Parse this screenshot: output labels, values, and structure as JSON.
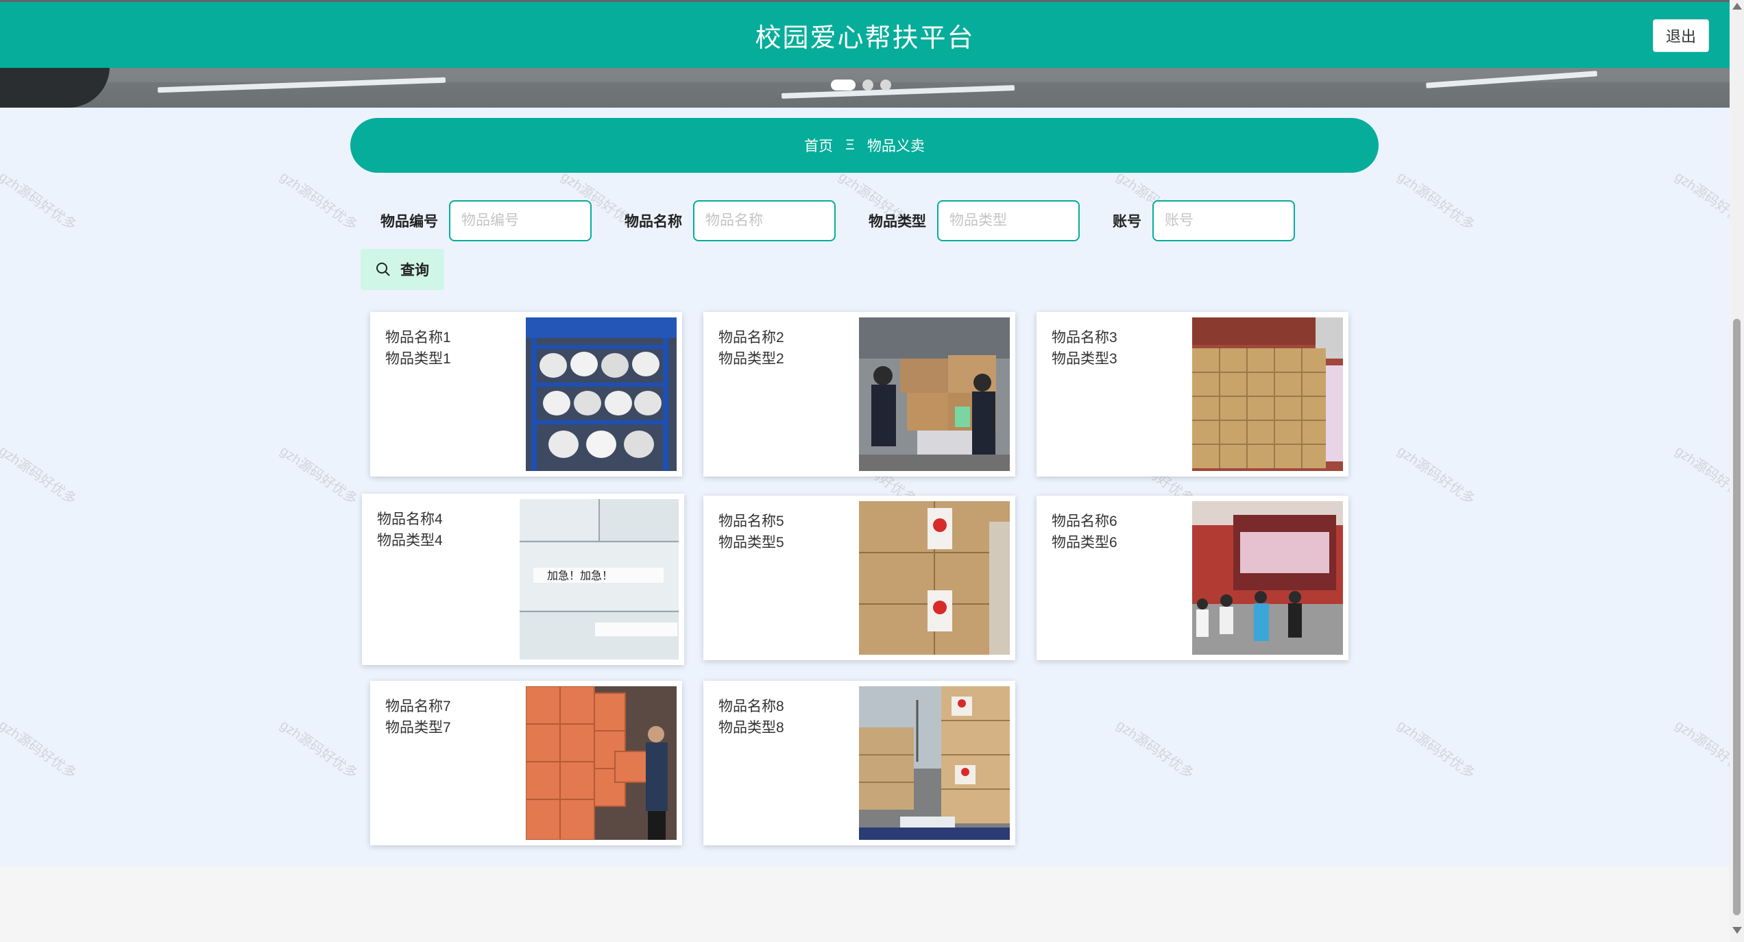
{
  "header": {
    "title": "校园爱心帮扶平台",
    "logout_label": "退出"
  },
  "breadcrumb": {
    "home": "首页",
    "separator": "Ξ",
    "current": "物品义卖"
  },
  "search": {
    "fields": [
      {
        "label": "物品编号",
        "placeholder": "物品编号"
      },
      {
        "label": "物品名称",
        "placeholder": "物品名称"
      },
      {
        "label": "物品类型",
        "placeholder": "物品类型"
      },
      {
        "label": "账号",
        "placeholder": "账号"
      }
    ],
    "query_label": "查询"
  },
  "items": [
    {
      "name": "物品名称1",
      "type": "物品类型1",
      "image": "shelf-bags"
    },
    {
      "name": "物品名称2",
      "type": "物品类型2",
      "image": "inspection-boxes"
    },
    {
      "name": "物品名称3",
      "type": "物品类型3",
      "image": "stacked-cartons"
    },
    {
      "name": "物品名称4",
      "type": "物品类型4",
      "image": "urgent-boxes"
    },
    {
      "name": "物品名称5",
      "type": "物品类型5",
      "image": "red-cross-boxes"
    },
    {
      "name": "物品名称6",
      "type": "物品类型6",
      "image": "truck-unloading"
    },
    {
      "name": "物品名称7",
      "type": "物品类型7",
      "image": "orange-boxes"
    },
    {
      "name": "物品名称8",
      "type": "物品类型8",
      "image": "airport-cargo"
    }
  ],
  "watermark": "gzh源码好优多",
  "colors": {
    "accent": "#05ad9a",
    "background": "#edf3fd",
    "query_button": "#d0f6e8"
  }
}
